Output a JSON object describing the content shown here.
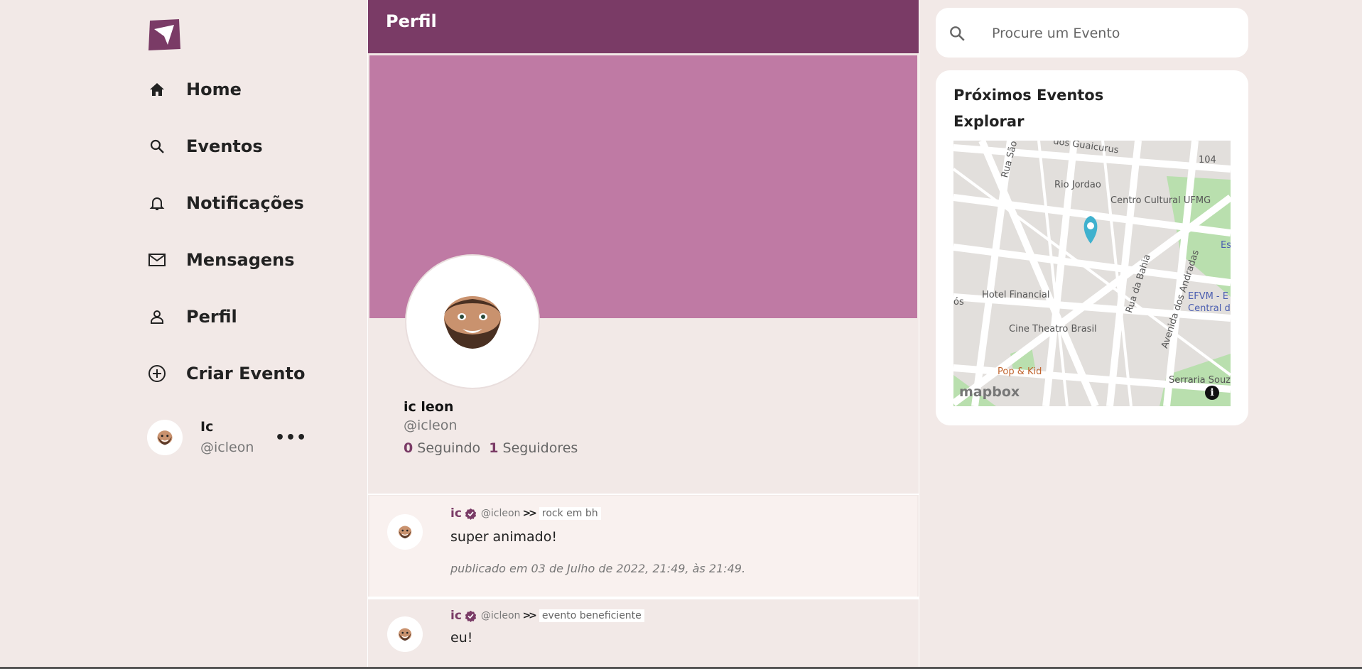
{
  "topbar": {
    "title": "Perfil"
  },
  "nav": {
    "items": [
      {
        "label": "Home",
        "icon": "home-icon"
      },
      {
        "label": "Eventos",
        "icon": "search-icon"
      },
      {
        "label": "Notificações",
        "icon": "bell-icon"
      },
      {
        "label": "Mensagens",
        "icon": "mail-icon"
      },
      {
        "label": "Perfil",
        "icon": "person-icon"
      },
      {
        "label": "Criar Evento",
        "icon": "plus-circle-icon"
      }
    ]
  },
  "account": {
    "name": "Ic",
    "handle": "@icleon",
    "more": "•••"
  },
  "profile": {
    "name": "ic leon",
    "handle": "@icleon",
    "following_count": "0",
    "following_label": "Seguindo",
    "followers_count": "1",
    "followers_label": "Seguidores"
  },
  "posts": [
    {
      "user": "ic",
      "handle": "@icleon",
      "event": "rock em bh",
      "text": "super animado!",
      "date": "publicado em 03 de Julho de 2022, 21:49, às 21:49."
    },
    {
      "user": "ic",
      "handle": "@icleon",
      "event": "evento beneficiente",
      "text": "eu!",
      "date": ""
    }
  ],
  "search": {
    "placeholder": "Procure um Evento"
  },
  "events_card": {
    "title": "Próximos Eventos",
    "explore": "Explorar"
  },
  "map": {
    "labels": [
      "Rio Jordao",
      "Centro Cultural UFMG",
      "Hotel Financial",
      "Cine Theatro Brasil",
      "Pop & Kid",
      "Rua da Bahia",
      "Avenida dos Andradas",
      "Serraria Souz",
      "EFVM - E",
      "Central d",
      "Rua São",
      "dos Guaicurus",
      "104",
      "Es",
      "ós"
    ],
    "brand": "mapbox"
  },
  "colors": {
    "brand": "#7a3b66",
    "cover": "#bf7aa4",
    "background": "#f2e9e7"
  }
}
